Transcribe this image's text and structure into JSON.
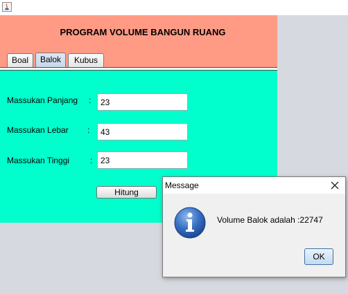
{
  "window": {
    "icon": "java-icon"
  },
  "header": {
    "title": "PROGRAM VOLUME BANGUN RUANG"
  },
  "tabs": [
    {
      "label": "Boal",
      "selected": false
    },
    {
      "label": "Balok",
      "selected": true
    },
    {
      "label": "Kubus",
      "selected": false
    }
  ],
  "form": {
    "fields": [
      {
        "label": "Massukan Panjang",
        "colon": ":",
        "value": "23"
      },
      {
        "label": "Massukan Lebar",
        "colon": ":",
        "value": "43"
      },
      {
        "label": "Massukan Tinggi",
        "colon": ":",
        "value": "23"
      }
    ],
    "button_label": "Hitung"
  },
  "dialog": {
    "title": "Message",
    "message": "Volume Balok adalah :22747",
    "ok_label": "OK",
    "icon": "info-icon",
    "close_icon": "close-icon"
  },
  "colors": {
    "header_bg": "#ff9a85",
    "content_bg": "#00ffcc",
    "desktop_bg": "#d6d9df"
  }
}
